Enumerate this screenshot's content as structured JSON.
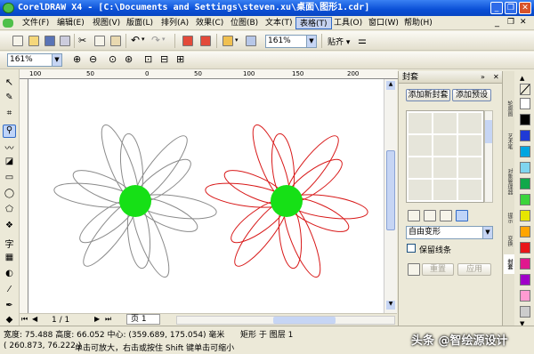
{
  "window": {
    "title": "CorelDRAW X4 - [C:\\Documents and Settings\\steven.xu\\桌面\\图形1.cdr]",
    "minimize_glyph": "_",
    "restore_glyph": "❐",
    "close_glyph": "✕"
  },
  "menu": [
    "文件(F)",
    "编辑(E)",
    "视图(V)",
    "版面(L)",
    "排列(A)",
    "效果(C)",
    "位图(B)",
    "文本(T)",
    "表格(T)",
    "工具(O)",
    "窗口(W)",
    "帮助(H)"
  ],
  "toolbar": {
    "zoom_value": "161%",
    "snap_label": "贴齐",
    "icons": [
      "new-icon",
      "open-icon",
      "save-icon",
      "print-icon",
      "cut-icon",
      "copy-icon",
      "paste-icon",
      "undo-icon",
      "redo-icon",
      "import-icon",
      "export-icon",
      "launcher-icon"
    ]
  },
  "zoom_bar": {
    "zoom_value": "161%"
  },
  "ruler": {
    "ticks": [
      "100",
      "50",
      "0",
      "50",
      "100",
      "150",
      "200"
    ]
  },
  "docker": {
    "title": "封套",
    "add_new_label": "添加新封套",
    "add_preset_label": "添加预设",
    "mode_value": "自由变形",
    "keep_lines_label": "保留线条",
    "reset_label": "重置",
    "apply_label": "应用",
    "tabs": [
      "轮廓图",
      "艺术笔",
      "对象管理器",
      "提示",
      "变换",
      "封套"
    ]
  },
  "palette": [
    "#ffffff",
    "#000000",
    "#1f3ad6",
    "#00a6e0",
    "#7fd5ef",
    "#10a84a",
    "#3bd43b",
    "#e6e600",
    "#ffa500",
    "#e8161a",
    "#e0178e",
    "#a000c8",
    "#ff9bd2",
    "#cccccc"
  ],
  "page_nav": {
    "page_count": "1 / 1",
    "page_tab": "页 1"
  },
  "status": {
    "size": "宽度: 75.488  高度: 66.052  中心: (359.689, 175.054)  毫米",
    "object_info": "矩形 于 图层 1",
    "cursor": "( 260.873, 76.222 )",
    "hint": "单击可放大，右击或按住 Shift 键单击可缩小"
  },
  "colors": {
    "left_flower": "#8a8a8a",
    "right_flower": "#d81818",
    "center_fill": "#16e016",
    "title_bar": "#0a4fd6"
  },
  "watermark": "头条 @智绘源设计"
}
